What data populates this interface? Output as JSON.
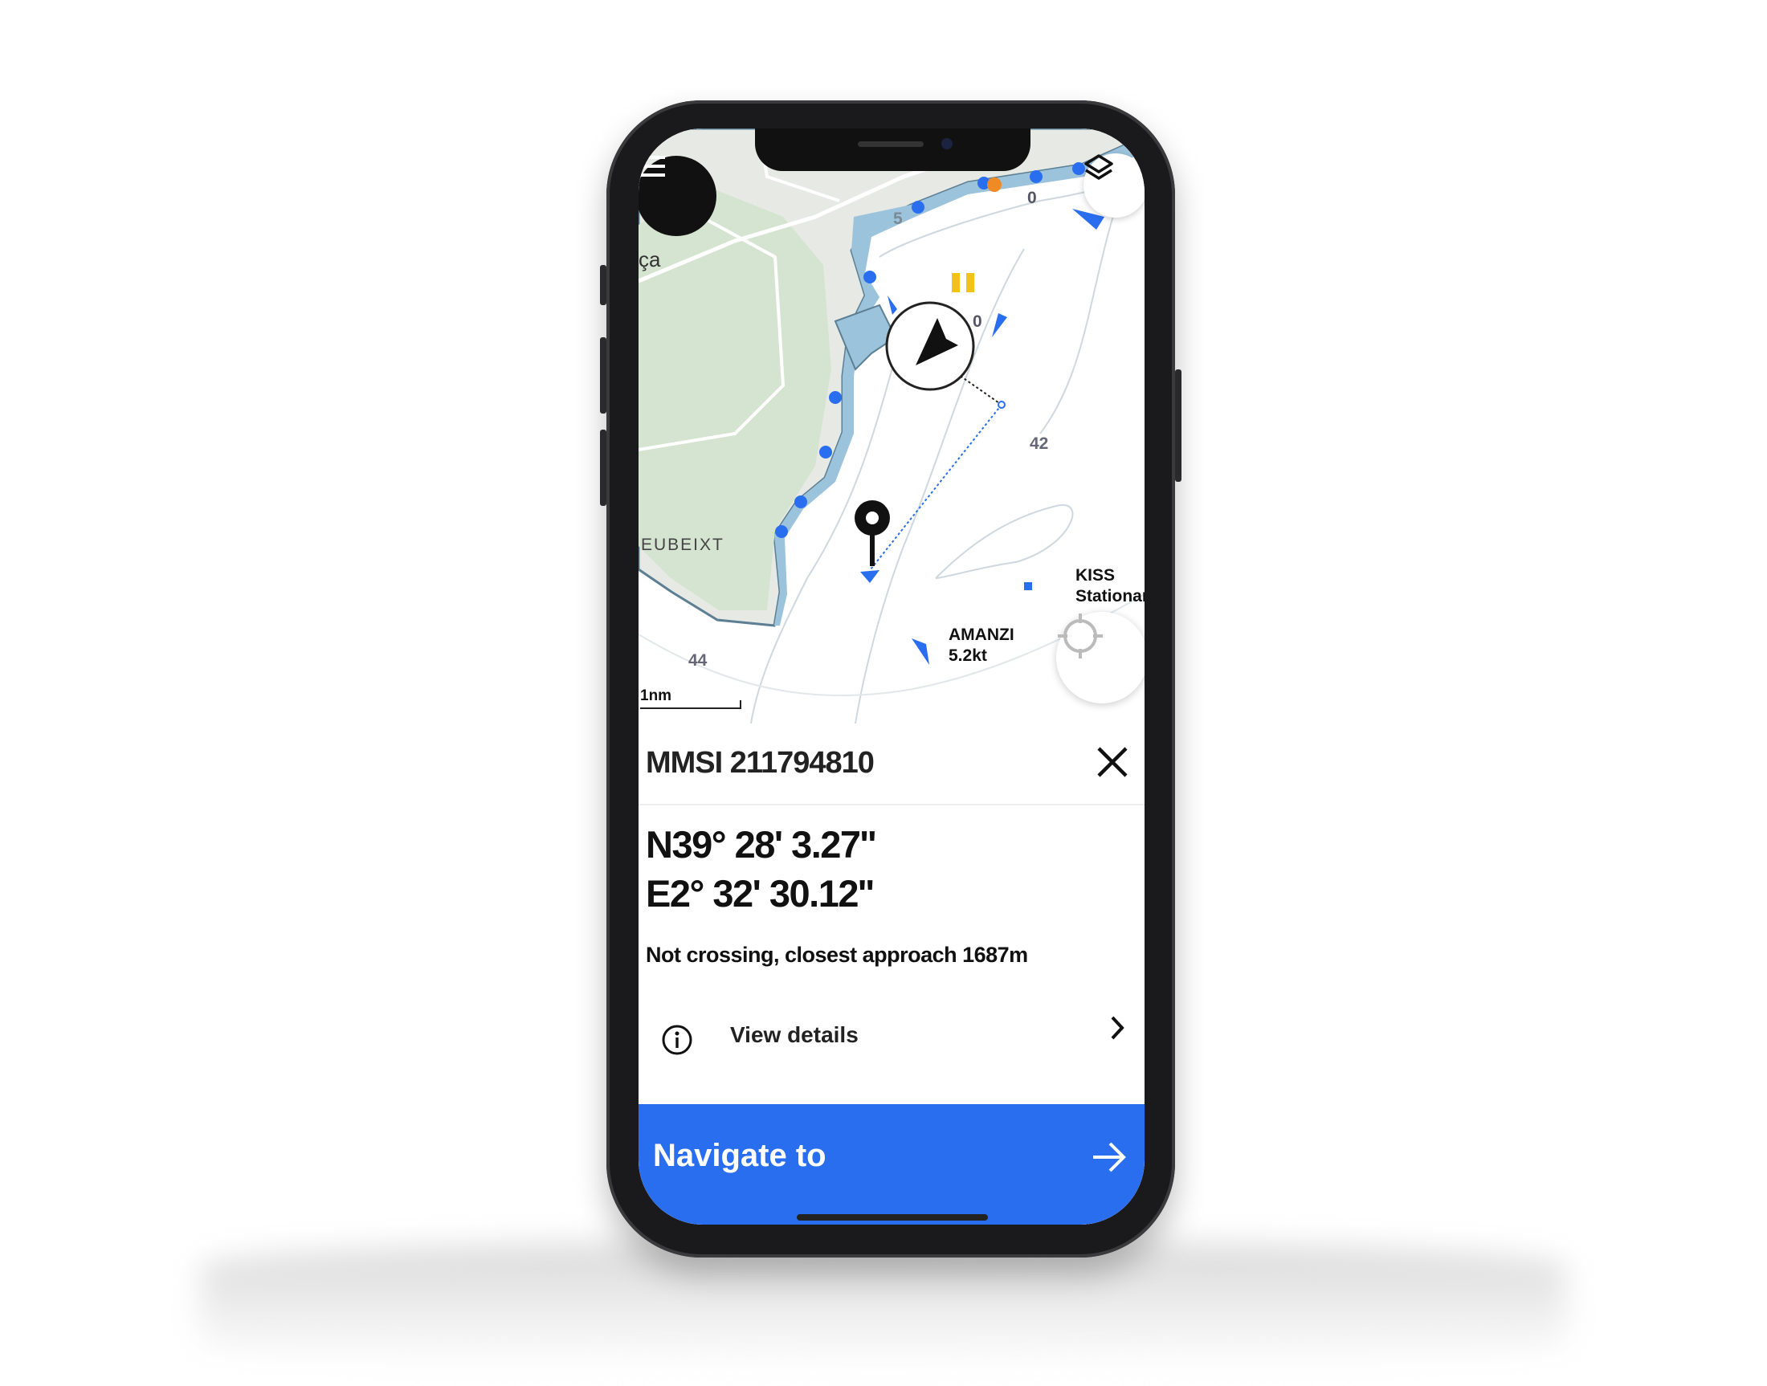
{
  "map": {
    "place_labels": [
      "ça",
      "EUBEIXT"
    ],
    "depth_labels": [
      "5",
      "0",
      "0",
      "42",
      "44"
    ],
    "scale_label": "1nm",
    "vessels": [
      {
        "name": "KISS",
        "detail": "Stationar"
      },
      {
        "name": "AMANZI",
        "detail": "5.2kt"
      }
    ],
    "icons": {
      "menu": "hamburger-icon",
      "layers": "layers-icon",
      "locate": "crosshair-icon",
      "own_ship": "navigation-arrow-icon",
      "target": "pin-icon"
    }
  },
  "panel": {
    "title": "MMSI 211794810",
    "latitude": "N39° 28' 3.27''",
    "longitude": "E2° 32' 30.12''",
    "status": "Not crossing, closest approach 1687m",
    "view_details_label": "View details",
    "navigate_label": "Navigate to"
  },
  "colors": {
    "accent": "#2a6ef0",
    "land": "#e7e9e5",
    "vegetation": "#d4e4d0",
    "shallow_water": "#9cc3dc",
    "vessel": "#2a6ef0"
  }
}
